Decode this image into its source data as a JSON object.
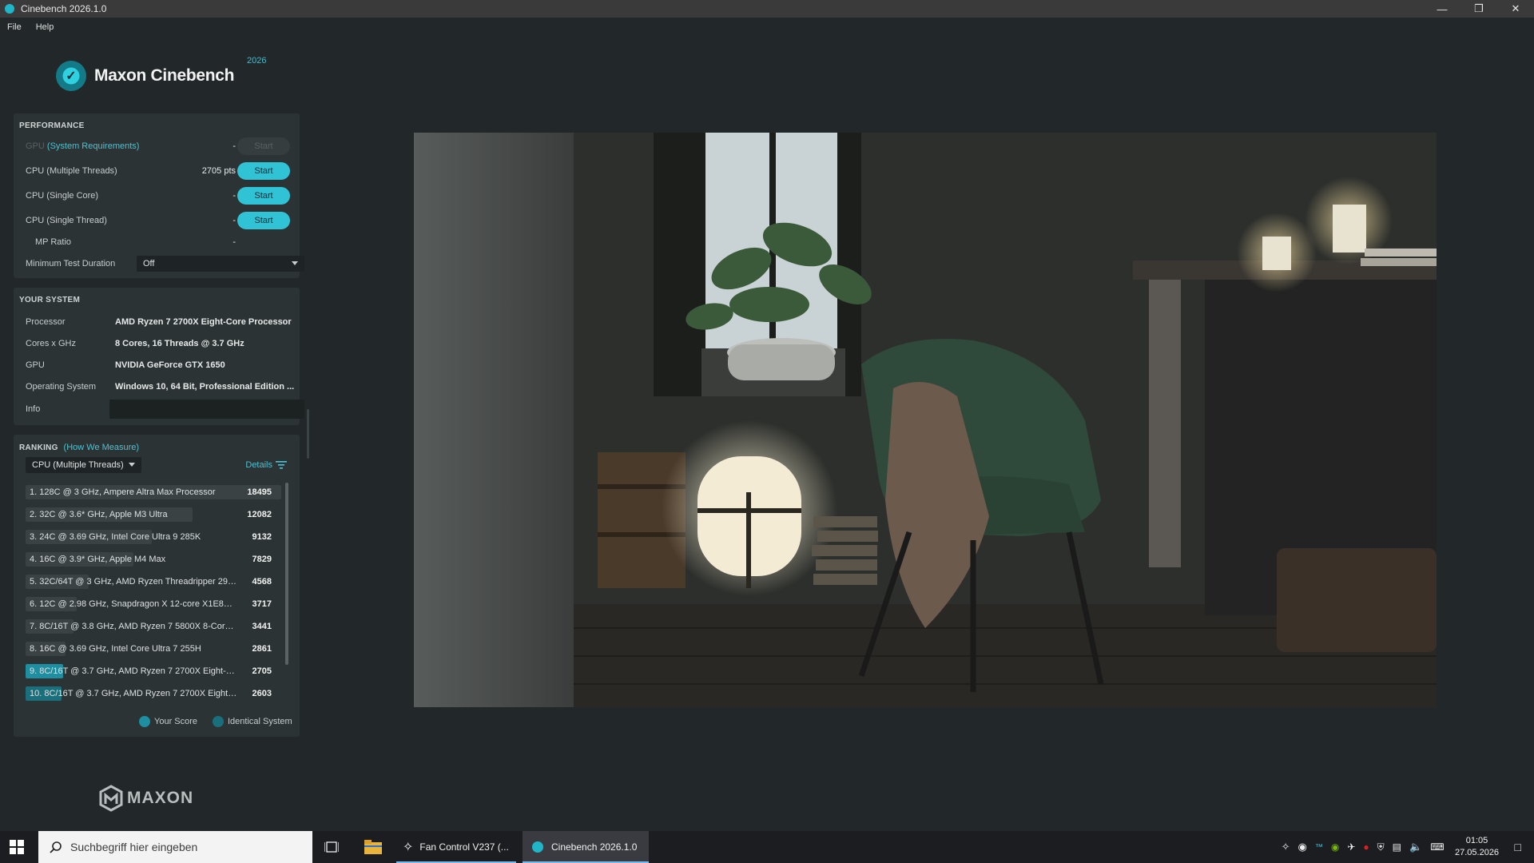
{
  "window": {
    "title": "Cinebench 2026.1.0",
    "controls": [
      "minimize",
      "restore",
      "close"
    ]
  },
  "menu": [
    "File",
    "Help"
  ],
  "logo": {
    "text": "Maxon Cinebench",
    "year": "2026"
  },
  "performance": {
    "title": "PERFORMANCE",
    "gpu": {
      "label": "GPU",
      "link": "(System Requirements)",
      "value": "-",
      "button": "Start"
    },
    "rows": [
      {
        "label": "CPU (Multiple Threads)",
        "value": "2705 pts",
        "button": "Start"
      },
      {
        "label": "CPU (Single Core)",
        "value": "-",
        "button": "Start"
      },
      {
        "label": "CPU (Single Thread)",
        "value": "-",
        "button": "Start"
      }
    ],
    "mp_ratio": {
      "label": "MP Ratio",
      "value": "-"
    },
    "min_duration": {
      "label": "Minimum Test Duration",
      "value": "Off"
    }
  },
  "your_system": {
    "title": "YOUR SYSTEM",
    "rows": [
      {
        "label": "Processor",
        "value": "AMD Ryzen 7 2700X Eight-Core Processor"
      },
      {
        "label": "Cores x GHz",
        "value": "8 Cores, 16 Threads @ 3.7 GHz"
      },
      {
        "label": "GPU",
        "value": "NVIDIA GeForce GTX 1650"
      },
      {
        "label": "Operating System",
        "value": "Windows 10, 64 Bit, Professional Edition ..."
      }
    ],
    "info_label": "Info"
  },
  "ranking": {
    "title": "RANKING",
    "link": "(How We Measure)",
    "mode": "CPU (Multiple Threads)",
    "details": "Details",
    "items": [
      {
        "label": "1. 128C @ 3 GHz, Ampere Altra Max Processor",
        "score": "18495",
        "fraction": 1.0,
        "type": "other"
      },
      {
        "label": "2. 32C @ 3.6* GHz, Apple M3 Ultra",
        "score": "12082",
        "fraction": 0.653,
        "type": "other"
      },
      {
        "label": "3. 24C @ 3.69 GHz, Intel Core Ultra 9 285K",
        "score": "9132",
        "fraction": 0.494,
        "type": "other"
      },
      {
        "label": "4. 16C @ 3.9* GHz, Apple M4 Max",
        "score": "7829",
        "fraction": 0.423,
        "type": "other"
      },
      {
        "label": "5. 32C/64T @ 3 GHz, AMD Ryzen Threadripper 2990...",
        "score": "4568",
        "fraction": 0.247,
        "type": "other"
      },
      {
        "label": "6. 12C @ 2.98 GHz, Snapdragon X 12-core X1E80100",
        "score": "3717",
        "fraction": 0.201,
        "type": "other"
      },
      {
        "label": "7. 8C/16T @ 3.8 GHz, AMD Ryzen 7 5800X 8-Core P...",
        "score": "3441",
        "fraction": 0.186,
        "type": "other"
      },
      {
        "label": "8. 16C @ 3.69 GHz, Intel Core Ultra 7 255H",
        "score": "2861",
        "fraction": 0.155,
        "type": "other"
      },
      {
        "label": "9. 8C/16T @ 3.7 GHz, AMD Ryzen 7 2700X Eight-Co...",
        "score": "2705",
        "fraction": 0.146,
        "type": "own"
      },
      {
        "label": "10. 8C/16T @ 3.7 GHz, AMD Ryzen 7 2700X Eight-C...",
        "score": "2603",
        "fraction": 0.141,
        "type": "ident"
      }
    ],
    "legend": {
      "your_score": "Your Score",
      "identical": "Identical System"
    },
    "colors": {
      "own": "#1d8fa0",
      "ident": "#19707c",
      "other": "#3a4243"
    }
  },
  "brand_footer": "MAXON",
  "taskbar": {
    "search_placeholder": "Suchbegriff hier eingeben",
    "apps": [
      {
        "label": "Fan Control V237 (...",
        "icon": "fan-icon"
      },
      {
        "label": "Cinebench 2026.1.0",
        "icon": "cinebench-icon",
        "active": true
      }
    ],
    "time": "01:05",
    "date": "27.05.2026"
  },
  "accent_color": "#30c3d6"
}
